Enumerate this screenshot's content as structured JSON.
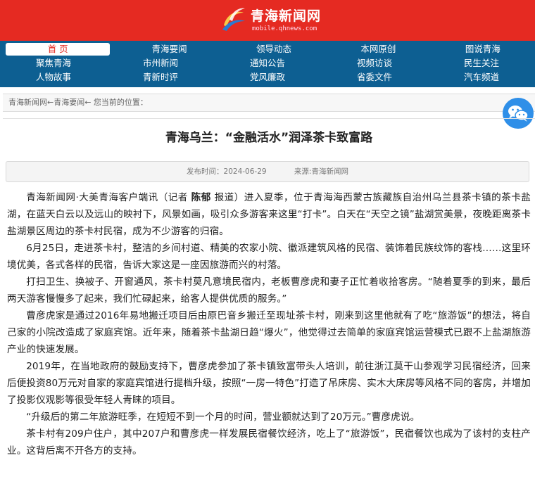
{
  "header": {
    "logo_title": "青海新闻网",
    "logo_url": "mobile.qhnews.com",
    "bg_color": "#e52a22"
  },
  "nav": {
    "bg_color": "#0d5f92",
    "rows": [
      [
        "首 页",
        "青海要闻",
        "领导动态",
        "本网原创",
        "图说青海"
      ],
      [
        "聚焦青海",
        "市州新闻",
        "通知公告",
        "视频访谈",
        "民生关注"
      ],
      [
        "人物故事",
        "青新时评",
        "党风廉政",
        "省委文件",
        "汽车频道"
      ]
    ]
  },
  "breadcrumb": {
    "text": "青海新闻网←青海要闻← 您当前的位置："
  },
  "wechat_icon": "wechat-icon",
  "article": {
    "title": "青海乌兰：“金融活水”润泽茶卡致富路",
    "publish_time": "发布时间：2024-06-29",
    "source": "来源:青海新闻网",
    "p1_before": "青海新闻网·大美青海客户端讯（记者 ",
    "p1_bold": "陈郁",
    "p1_after": " 报道）进入夏季，位于青海海西蒙古族藏族自治州乌兰县茶卡镇的茶卡盐湖，在蓝天白云以及远山的映衬下，风景如画，吸引众多游客来这里“打卡”。白天在“天空之镜”盐湖赏美景，夜晚距离茶卡盐湖景区周边的茶卡村民宿，成为不少游客的归宿。",
    "p2": "6月25日，走进茶卡村，整洁的乡间村道、精美的农家小院、徽派建筑风格的民宿、装饰着民族纹饰的客栈……这里环境优美，各式各样的民宿，告诉大家这是一座因旅游而兴的村落。",
    "p3": "打扫卫生、换被子、开窗通风，茶卡村莫凡意境民宿内，老板曹彦虎和妻子正忙着收拾客房。“随着夏季的到来，最后两天游客慢慢多了起来，我们忙碌起来，给客人提供优质的服务。”",
    "p4": "曹彦虎家是通过2016年易地搬迁项目后由原巴音乡搬迁至现址茶卡村，刚来到这里他就有了吃“旅游饭”的想法，将自己家的小院改造成了家庭宾馆。近年来，随着茶卡盐湖日趋“爆火”，他觉得过去简单的家庭宾馆运营模式已跟不上盐湖旅游产业的快速发展。",
    "p5": "2019年，在当地政府的鼓励支持下，曹彦虎参加了茶卡镇致富带头人培训，前往浙江莫干山参观学习民宿经济，回来后便投资80万元对自家的家庭宾馆进行提档升级，按照“一房一特色”打造了吊床房、实木大床房等风格不同的客房，并增加了投影仪观影等很受年轻人青睐的项目。",
    "p6": "“升级后的第二年旅游旺季，在短短不到一个月的时间，营业额就达到了20万元。”曹彦虎说。",
    "p7": "茶卡村有209户住户，其中207户和曹彦虎一样发展民宿餐饮经济，吃上了“旅游饭”，民宿餐饮也成为了该村的支柱产业。这背后离不开各方的支持。"
  }
}
